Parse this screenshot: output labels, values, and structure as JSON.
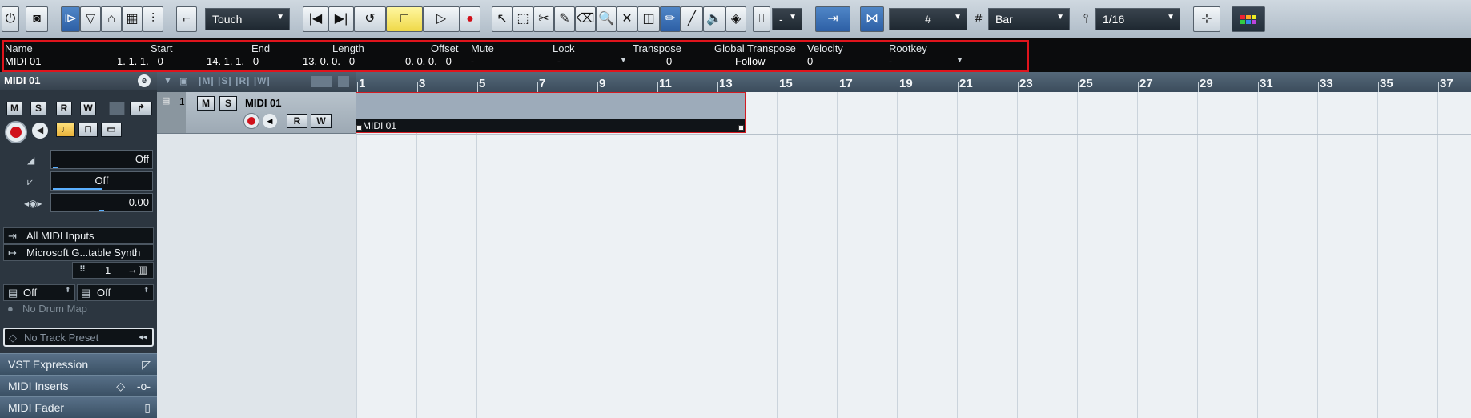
{
  "toolbar": {
    "automation_mode": "Touch",
    "nudge_value": "-",
    "grid_type": "Bar",
    "quantize": "1/16"
  },
  "infoline": {
    "headers": [
      "Name",
      "Start",
      "End",
      "Length",
      "Offset",
      "Mute",
      "Lock",
      "Transpose",
      "Global Transpose",
      "Velocity",
      "Rootkey"
    ],
    "values": {
      "name": "MIDI 01",
      "start": "1. 1. 1.   0",
      "end": "14. 1. 1.   0",
      "length": "13. 0. 0.   0",
      "offset": "0. 0. 0.   0",
      "mute": "-",
      "lock": "-",
      "transpose": "0",
      "global_transpose": "Follow",
      "velocity": "0",
      "rootkey": "-"
    }
  },
  "inspector": {
    "track_name": "MIDI 01",
    "volume": "Off",
    "pan": "Off",
    "delay": "0.00",
    "input": "All MIDI Inputs",
    "output": "Microsoft G...table Synth",
    "channel": "1",
    "bank": "Off",
    "program": "Off",
    "drum_map": "No Drum Map",
    "track_preset": "No Track Preset",
    "sections": [
      "VST Expression",
      "MIDI Inserts",
      "MIDI Fader"
    ],
    "buttons": {
      "m": "M",
      "s": "S",
      "r": "R",
      "w": "W"
    }
  },
  "tracklist": {
    "track_number": "1",
    "track_name": "MIDI 01",
    "m": "M",
    "s": "S",
    "r": "R",
    "w": "W"
  },
  "ruler": {
    "bars": [
      "1",
      "3",
      "5",
      "7",
      "9",
      "11",
      "13",
      "15",
      "17",
      "19",
      "21",
      "23",
      "25",
      "27",
      "29",
      "31",
      "33",
      "35",
      "37"
    ]
  },
  "part": {
    "name": "MIDI 01"
  },
  "colors": {
    "accent_red": "#e0141c",
    "part_fill": "#9dabba",
    "selected_blue": "#2d5fa5"
  }
}
